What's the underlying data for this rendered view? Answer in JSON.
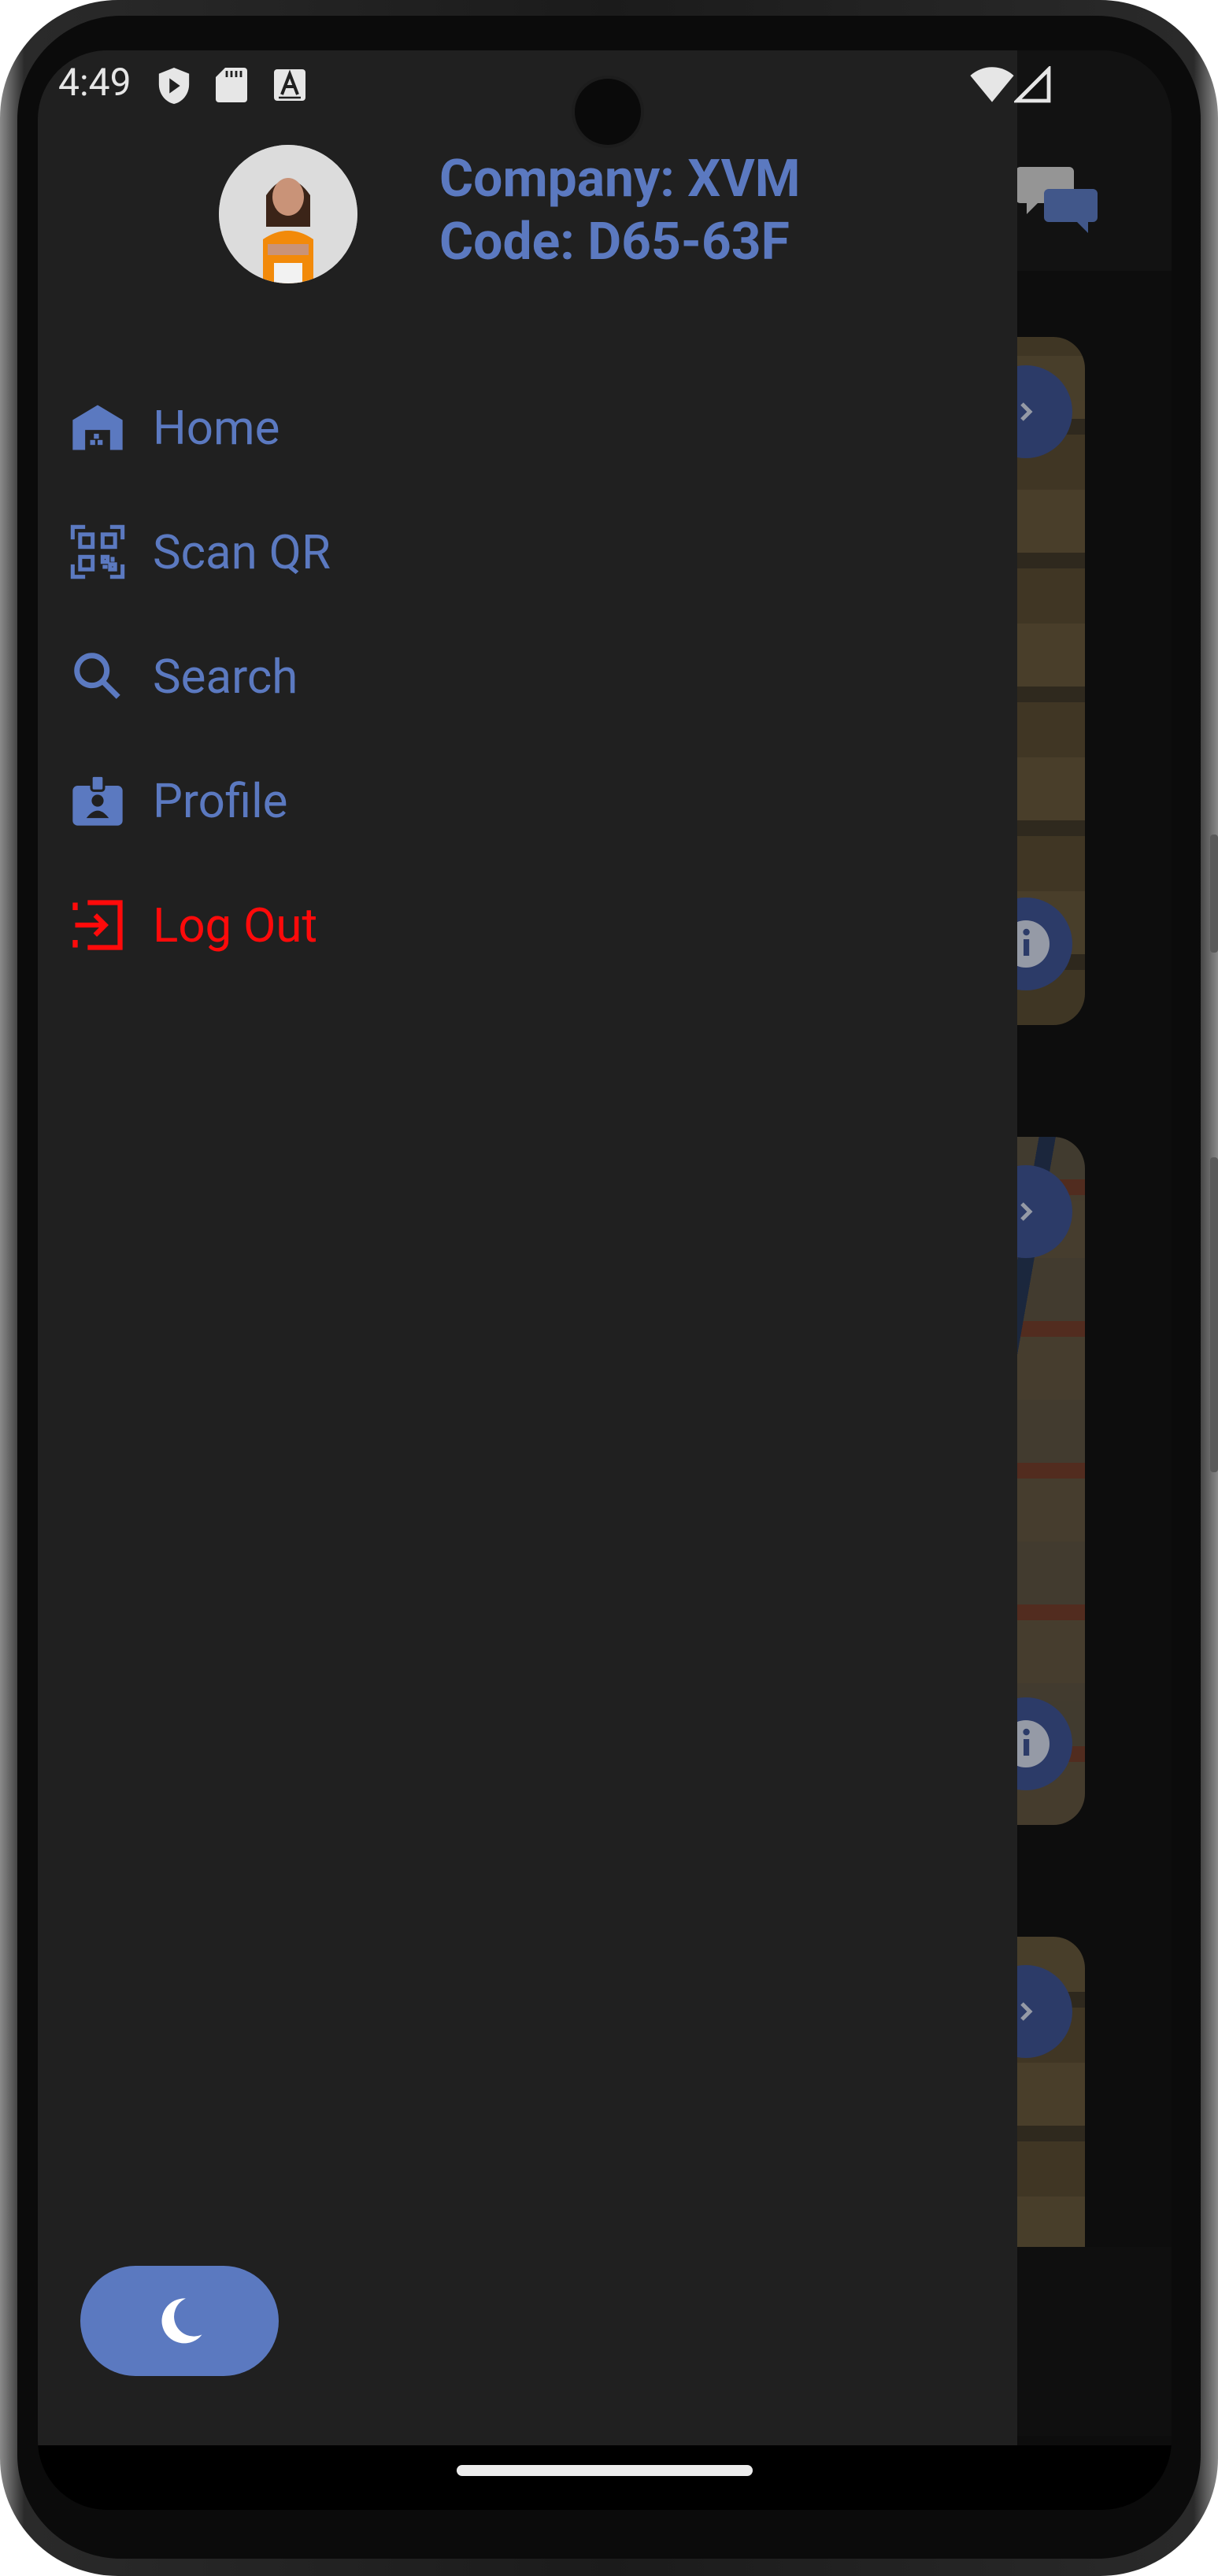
{
  "status_bar": {
    "time": "4:49",
    "left_icons": [
      "play-protect-icon",
      "sd-card-icon",
      "font-a-icon"
    ],
    "right_icons": [
      "wifi-icon",
      "cell-signal-icon"
    ]
  },
  "drawer": {
    "company_line": "Company: XVM",
    "code_line": "Code: D65-63F",
    "menu": [
      {
        "label": "Home",
        "icon": "warehouse-icon"
      },
      {
        "label": "Scan QR",
        "icon": "qr-scan-icon"
      },
      {
        "label": "Search",
        "icon": "search-icon"
      },
      {
        "label": "Profile",
        "icon": "id-badge-icon"
      },
      {
        "label": "Log Out",
        "icon": "logout-icon"
      }
    ],
    "theme_toggle_icon": "moon-icon"
  },
  "colors": {
    "accent": "#5b79c0",
    "logout": "#ff0a0a",
    "drawer_bg": "#202020"
  }
}
